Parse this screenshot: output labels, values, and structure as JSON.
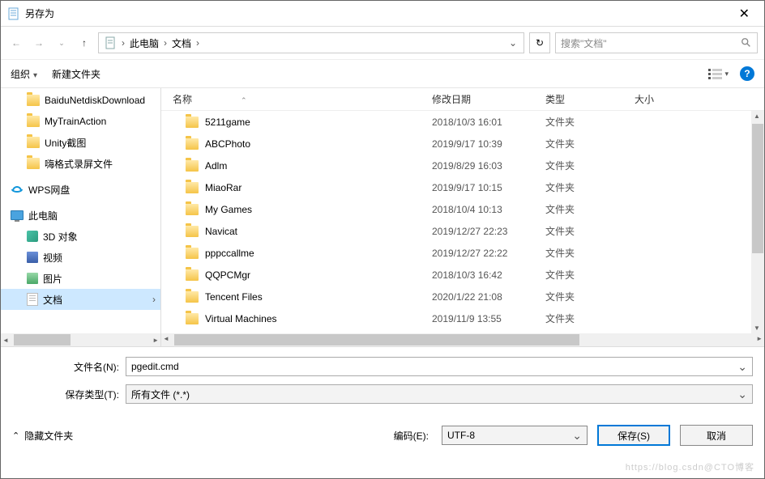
{
  "title": "另存为",
  "breadcrumb": {
    "seg1": "此电脑",
    "seg2": "文档"
  },
  "search_placeholder": "搜索\"文档\"",
  "toolbar": {
    "organize": "组织",
    "newfolder": "新建文件夹"
  },
  "sidebar": [
    {
      "icon": "folder",
      "label": "BaiduNetdiskDownload"
    },
    {
      "icon": "folder",
      "label": "MyTrainAction"
    },
    {
      "icon": "folder",
      "label": "Unity截图"
    },
    {
      "icon": "folder",
      "label": "嗨格式录屏文件"
    },
    {
      "icon": "wps",
      "label": "WPS网盘",
      "group": true
    },
    {
      "icon": "pc",
      "label": "此电脑",
      "group": true
    },
    {
      "icon": "cube",
      "label": "3D 对象"
    },
    {
      "icon": "video",
      "label": "视频"
    },
    {
      "icon": "pic",
      "label": "图片"
    },
    {
      "icon": "doc",
      "label": "文档",
      "selected": true
    }
  ],
  "columns": {
    "name": "名称",
    "date": "修改日期",
    "type": "类型",
    "size": "大小"
  },
  "files": [
    {
      "name": "5211game",
      "date": "2018/10/3 16:01",
      "type": "文件夹"
    },
    {
      "name": "ABCPhoto",
      "date": "2019/9/17 10:39",
      "type": "文件夹"
    },
    {
      "name": "Adlm",
      "date": "2019/8/29 16:03",
      "type": "文件夹"
    },
    {
      "name": "MiaoRar",
      "date": "2019/9/17 10:15",
      "type": "文件夹"
    },
    {
      "name": "My Games",
      "date": "2018/10/4 10:13",
      "type": "文件夹"
    },
    {
      "name": "Navicat",
      "date": "2019/12/27 22:23",
      "type": "文件夹"
    },
    {
      "name": "pppccallme",
      "date": "2019/12/27 22:22",
      "type": "文件夹"
    },
    {
      "name": "QQPCMgr",
      "date": "2018/10/3 16:42",
      "type": "文件夹"
    },
    {
      "name": "Tencent Files",
      "date": "2020/1/22 21:08",
      "type": "文件夹"
    },
    {
      "name": "Virtual Machines",
      "date": "2019/11/9 13:55",
      "type": "文件夹"
    }
  ],
  "labels": {
    "filename": "文件名(N):",
    "filetype": "保存类型(T):",
    "encoding": "编码(E):",
    "hide": "隐藏文件夹"
  },
  "values": {
    "filename": "pgedit.cmd",
    "filetype": "所有文件  (*.*)",
    "encoding": "UTF-8"
  },
  "buttons": {
    "save": "保存(S)",
    "cancel": "取消"
  },
  "watermark": "https://blog.csdn@CTO博客"
}
